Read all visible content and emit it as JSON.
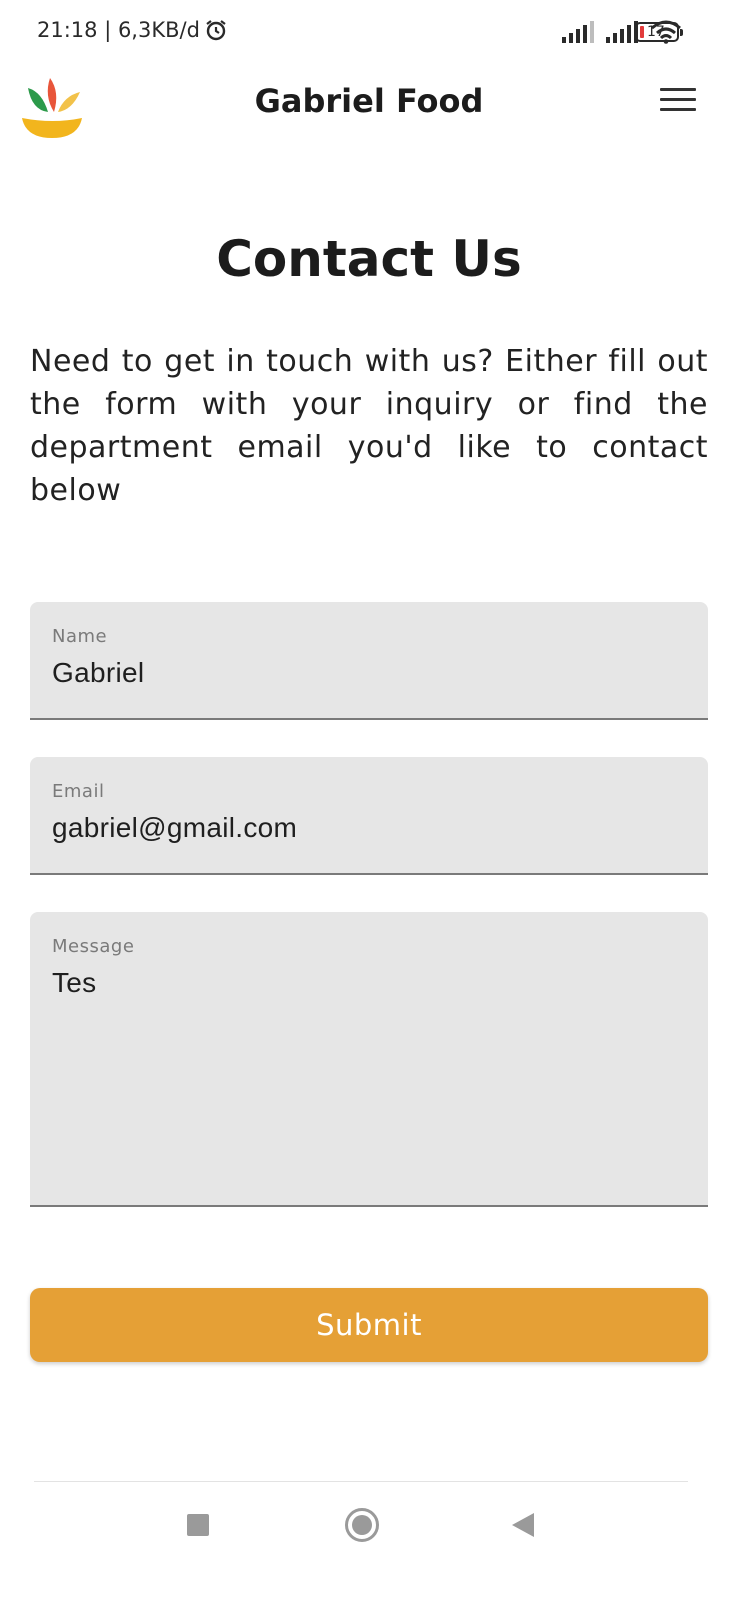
{
  "status_bar": {
    "time_speed": "21:18 | 6,3KB/d",
    "battery_level": "17"
  },
  "app_bar": {
    "title": "Gabriel Food"
  },
  "page": {
    "title": "Contact Us",
    "intro": "Need to get in touch with us? Either fill out the form with your inquiry or find the department email you'd like to contact below"
  },
  "form": {
    "name": {
      "label": "Name",
      "value": "Gabriel"
    },
    "email": {
      "label": "Email",
      "value": "gabriel@gmail.com"
    },
    "message": {
      "label": "Message",
      "value": "Tes"
    },
    "submit_label": "Submit"
  },
  "colors": {
    "accent": "#e5a036",
    "field_background": "#e6e6e6",
    "text": "#1c1c1c"
  },
  "icons": {
    "status": [
      "alarm-icon",
      "signal-icon",
      "wifi-icon",
      "battery-icon"
    ],
    "app_bar": [
      "logo-icon",
      "menu-icon"
    ],
    "navigation": [
      "recents-icon",
      "home-icon",
      "back-icon"
    ]
  }
}
